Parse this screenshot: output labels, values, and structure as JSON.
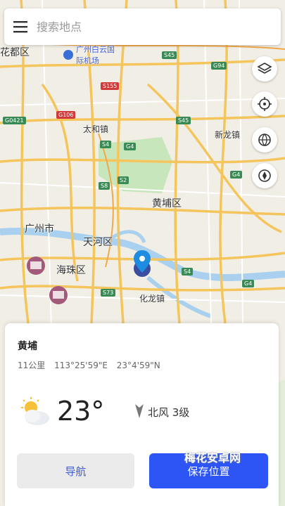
{
  "search": {
    "placeholder": "搜索地点"
  },
  "map": {
    "labels": {
      "huadu": "花都区",
      "baiyun_airport": "广州白云国际机场",
      "taihe": "太和镇",
      "xinlong": "新龙镇",
      "huangpu_qu": "黄埔区",
      "guangzhou": "广州市",
      "tianhe": "天河区",
      "haizhu": "海珠区",
      "hualong": "化龙镇"
    },
    "roads": {
      "s45a": "S45",
      "g94": "G94",
      "g0421": "G0421",
      "g106": "G106",
      "s155": "S155",
      "s4": "S4",
      "g4": "G4",
      "s8": "S8",
      "s2": "S2",
      "s45b": "S45",
      "g4b": "G4",
      "s73": "S73",
      "s4b": "S4",
      "g4c": "G4"
    }
  },
  "controls": [
    "layers-icon",
    "locate-icon",
    "globe-icon",
    "compass-icon"
  ],
  "panel": {
    "name": "黄埔",
    "distance": "11公里",
    "longitude": "113°25'59\"E",
    "latitude": "23°4'59\"N",
    "temperature": "23°",
    "wind": "北风 3级",
    "nav_label": "导航",
    "save_label": "保存位置"
  },
  "watermark": "梅花安卓网",
  "colors": {
    "accent": "#2d55f5",
    "marker": "#1e8ce0"
  }
}
